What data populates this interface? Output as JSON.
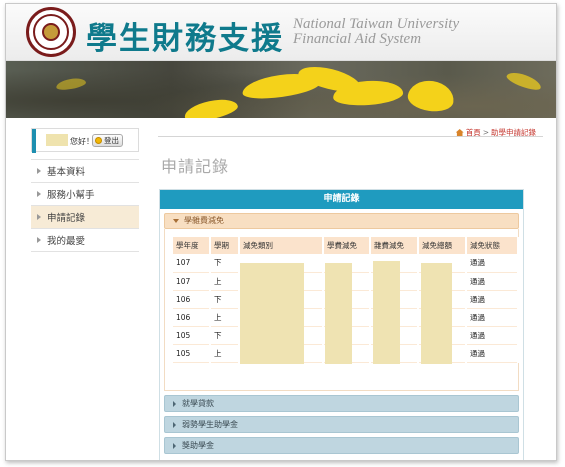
{
  "header": {
    "title_zh": "學生財務支援",
    "title_en_line1": "National Taiwan University",
    "title_en_line2": "Financial Aid System",
    "accent_color": "#0f7a8c"
  },
  "user": {
    "greeting": "您好！",
    "logout_label": "登出"
  },
  "sidebar": {
    "items": [
      {
        "label": "基本資料",
        "active": false
      },
      {
        "label": "服務小幫手",
        "active": false
      },
      {
        "label": "申請記錄",
        "active": true
      },
      {
        "label": "我的最愛",
        "active": false
      }
    ]
  },
  "breadcrumb": {
    "home": "首頁",
    "separator": ">",
    "current": "助學申請記錄"
  },
  "page_title": "申請記錄",
  "panel": {
    "title": "申請記錄",
    "open_section": "學雜費減免",
    "table": {
      "headers": [
        "學年度",
        "學期",
        "減免類別",
        "學費減免",
        "雜費減免",
        "減免總額",
        "減免狀態"
      ],
      "rows": [
        {
          "year": "107",
          "term": "下",
          "status": "通過"
        },
        {
          "year": "107",
          "term": "上",
          "status": "通過"
        },
        {
          "year": "106",
          "term": "下",
          "status": "通過"
        },
        {
          "year": "106",
          "term": "上",
          "status": "通過"
        },
        {
          "year": "105",
          "term": "下",
          "status": "通過"
        },
        {
          "year": "105",
          "term": "上",
          "status": "通過"
        }
      ]
    },
    "collapsed_sections": [
      "就學貸款",
      "弱勢學生助學金",
      "獎助學金"
    ]
  }
}
